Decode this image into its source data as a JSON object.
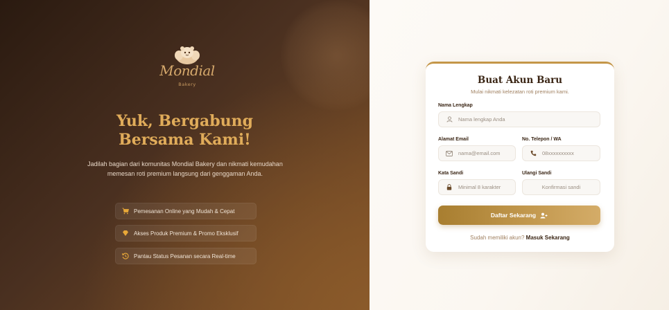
{
  "left": {
    "logo_text": "Mondial",
    "logo_sub": "Bakery",
    "hero_title_line1": "Yuk, Bergabung",
    "hero_title_line2": "Bersama Kami!",
    "hero_description": "Jadilah bagian dari komunitas Mondial Bakery dan nikmati kemudahan memesan roti premium langsung dari genggaman Anda.",
    "features": [
      {
        "icon": "cart-icon",
        "label": "Pemesanan Online yang Mudah & Cepat"
      },
      {
        "icon": "gem-icon",
        "label": "Akses Produk Premium & Promo Eksklusif"
      },
      {
        "icon": "history-icon",
        "label": "Pantau Status Pesanan secara Real-time"
      }
    ]
  },
  "form": {
    "title": "Buat Akun Baru",
    "subtitle": "Mulai nikmati kelezatan roti premium kami.",
    "name_label": "Nama Lengkap",
    "name_placeholder": "Nama lengkap Anda",
    "email_label": "Alamat Email",
    "email_placeholder": "nama@email.com",
    "phone_label": "No. Telepon / WA",
    "phone_placeholder": "08xxxxxxxxxx",
    "password_label": "Kata Sandi",
    "password_placeholder": "Minimal 8 karakter",
    "confirm_label": "Ulangi Sandi",
    "confirm_placeholder": "Konfirmasi sandi",
    "submit_label": "Daftar Sekarang",
    "login_prompt": "Sudah memiliki akun?",
    "login_link": "Masuk Sekarang"
  },
  "colors": {
    "accent": "#c49648",
    "heading": "#e0ac5a",
    "dark_text": "#3a2514"
  }
}
